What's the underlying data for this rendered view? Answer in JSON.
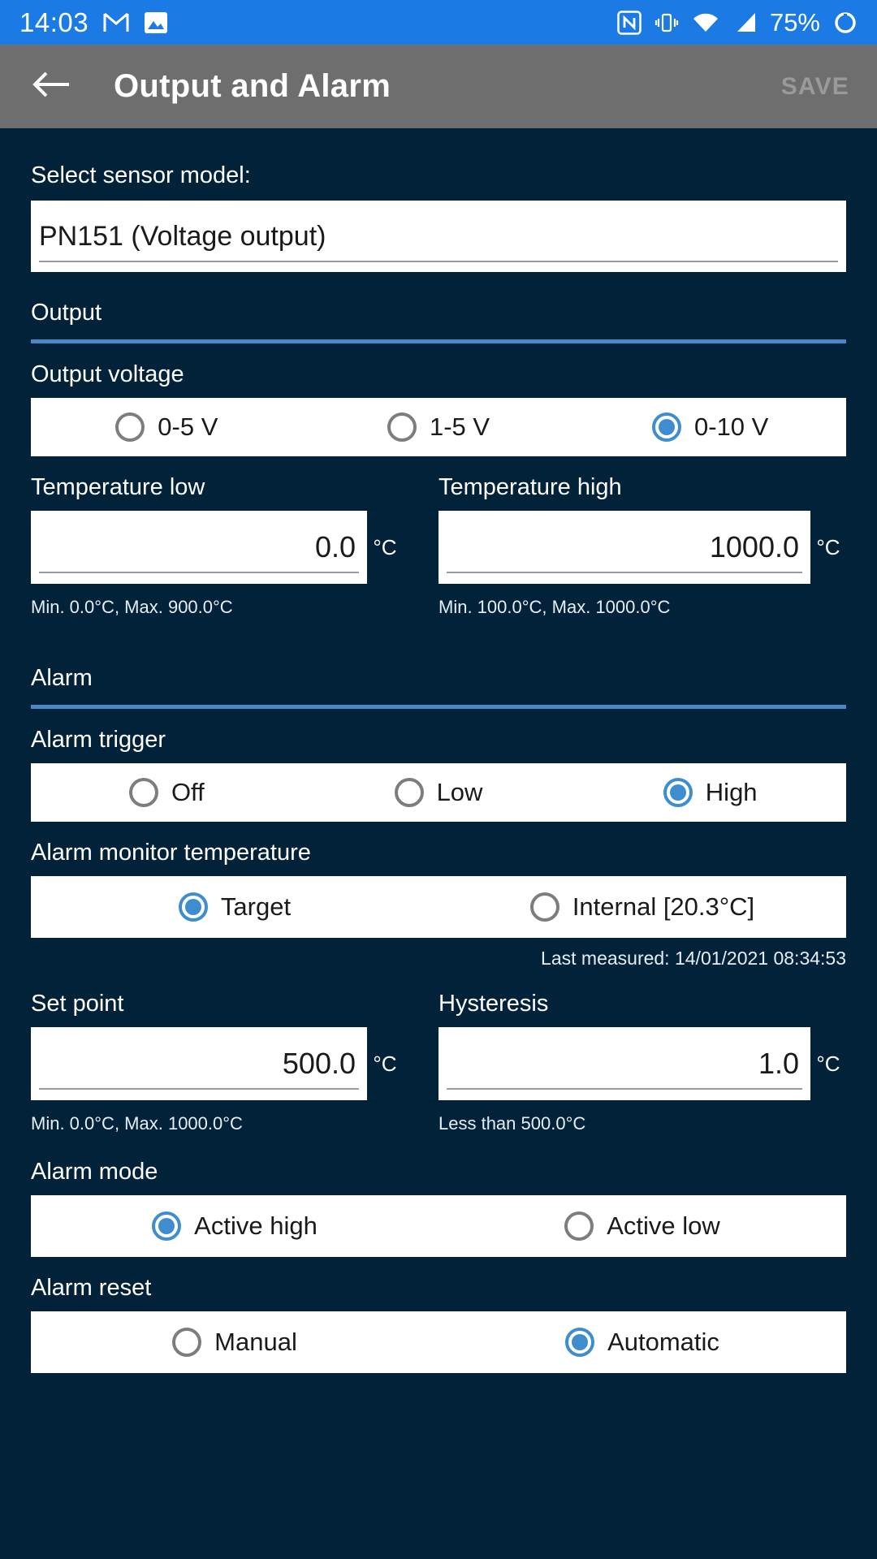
{
  "statusbar": {
    "time": "14:03",
    "battery_text": "75%",
    "icons": [
      "gmail-icon",
      "photos-icon",
      "nfc-icon",
      "vibrate-icon",
      "wifi-icon",
      "cellular-signal-icon",
      "battery-charging-icon"
    ],
    "background_color": "#1b7ae4"
  },
  "appbar": {
    "title": "Output and Alarm",
    "save_label": "SAVE",
    "background_color": "#6e6e6e"
  },
  "sensor": {
    "label": "Select sensor model:",
    "value": "PN151 (Voltage output)"
  },
  "output_section": {
    "title": "Output",
    "voltage": {
      "label": "Output voltage",
      "options": [
        {
          "label": "0-5 V",
          "selected": false
        },
        {
          "label": "1-5 V",
          "selected": false
        },
        {
          "label": "0-10 V",
          "selected": true
        }
      ]
    },
    "temperature_low": {
      "label": "Temperature low",
      "value": "0.0",
      "unit": "°C",
      "hint": "Min. 0.0°C, Max. 900.0°C"
    },
    "temperature_high": {
      "label": "Temperature high",
      "value": "1000.0",
      "unit": "°C",
      "hint": "Min. 100.0°C, Max. 1000.0°C"
    }
  },
  "alarm_section": {
    "title": "Alarm",
    "trigger": {
      "label": "Alarm trigger",
      "options": [
        {
          "label": "Off",
          "selected": false
        },
        {
          "label": "Low",
          "selected": false
        },
        {
          "label": "High",
          "selected": true
        }
      ]
    },
    "monitor_temperature": {
      "label": "Alarm monitor temperature",
      "options": [
        {
          "label": "Target",
          "selected": true
        },
        {
          "label": "Internal [20.3°C]",
          "selected": false
        }
      ],
      "last_measured": "Last measured: 14/01/2021 08:34:53"
    },
    "set_point": {
      "label": "Set point",
      "value": "500.0",
      "unit": "°C",
      "hint": "Min. 0.0°C, Max. 1000.0°C"
    },
    "hysteresis": {
      "label": "Hysteresis",
      "value": "1.0",
      "unit": "°C",
      "hint": "Less than 500.0°C"
    },
    "mode": {
      "label": "Alarm mode",
      "options": [
        {
          "label": "Active high",
          "selected": true
        },
        {
          "label": "Active low",
          "selected": false
        }
      ]
    },
    "reset": {
      "label": "Alarm reset",
      "options": [
        {
          "label": "Manual",
          "selected": false
        },
        {
          "label": "Automatic",
          "selected": true
        }
      ]
    }
  },
  "colors": {
    "background": "#02223a",
    "accent": "#3f8dcf",
    "rule": "#4d86c4",
    "status_blue": "#1b7ae4"
  }
}
